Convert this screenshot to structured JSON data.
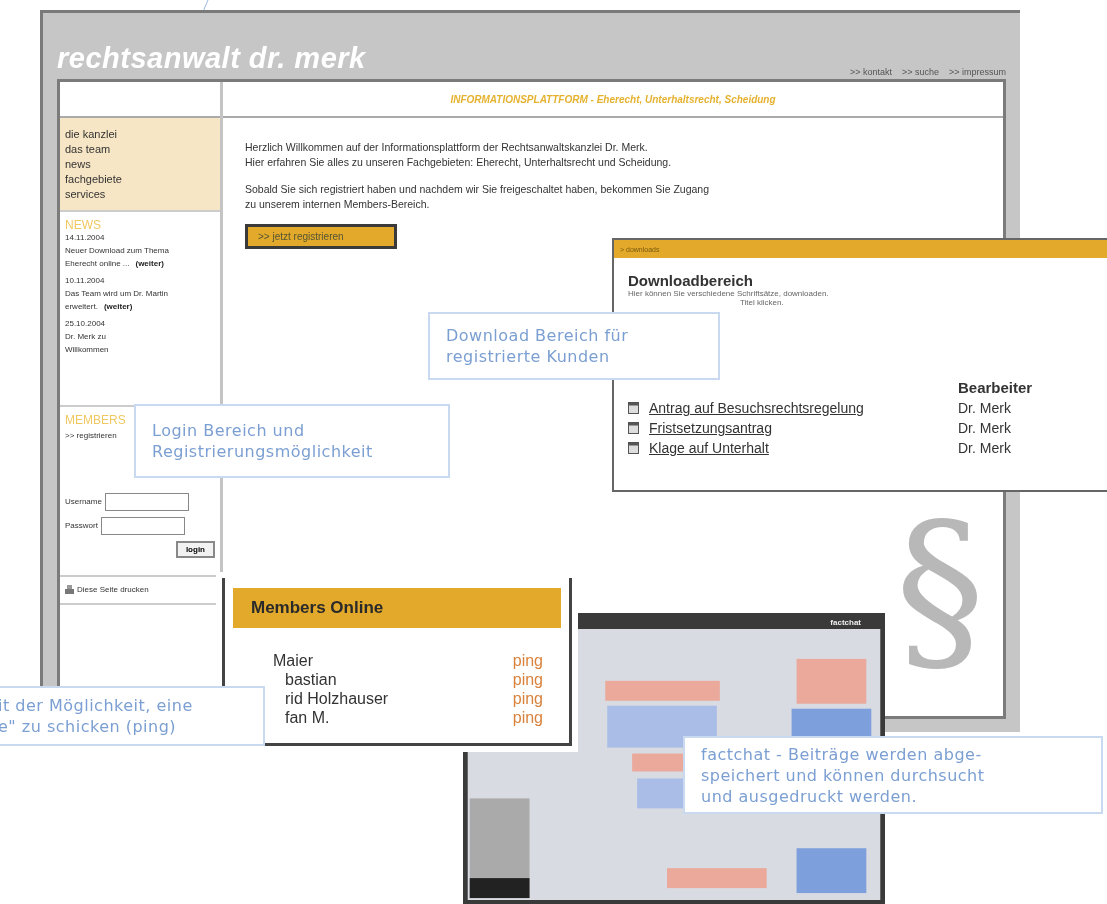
{
  "site": {
    "logo": "rechtsanwalt dr. merk",
    "top_links": [
      ">> kontakt",
      ">> suche",
      ">> impressum"
    ],
    "headline": "INFORMATIONSPLATTFORM - Eherecht, Unterhaltsrecht, Scheidung",
    "nav": [
      {
        "label": "die kanzlei"
      },
      {
        "label": "das team"
      },
      {
        "label": "news"
      },
      {
        "label": "fachgebiete"
      },
      {
        "label": "services"
      }
    ],
    "news_title": "NEWS",
    "news": [
      {
        "date": "14.11.2004",
        "lines": [
          "Neuer Download zum Thema",
          "Eherecht online ..."
        ],
        "more": "(weiter)"
      },
      {
        "date": "10.11.2004",
        "lines": [
          "Das Team wird um Dr. Martin",
          "erweitert."
        ],
        "more": "(weiter)"
      },
      {
        "date": "25.10.2004",
        "lines": [
          "Dr. Merk zu",
          "Willkommen"
        ]
      }
    ],
    "members_title": "MEMBERS",
    "register_link": ">> registrieren",
    "username_label": "Username",
    "password_label": "Passwort",
    "login_button": "login",
    "print_link": "Diese Seite drucken",
    "intro": [
      "Herzlich Willkommen auf der Informationsplattform der Rechtsanwaltskanzlei Dr. Merk.",
      "Hier erfahren Sie alles zu unseren Fachgebieten: Eherecht, Unterhaltsrecht und Scheidung."
    ],
    "intro2": [
      "Sobald Sie sich registriert haben und nachdem wir Sie freigeschaltet haben, bekommen Sie Zugang",
      "zu unserem internen Members-Bereich."
    ],
    "register_button": ">> jetzt registrieren"
  },
  "downloads": {
    "breadcrumb": "> downloads",
    "title": "Downloadbereich",
    "intro_lines": [
      "Hier können Sie verschiedene Schriftsätze, downloaden.",
      "Titel klicken."
    ],
    "author_header": "Bearbeiter",
    "rows": [
      {
        "title": "Antrag auf Besuchsrechtsregelung",
        "author": "Dr. Merk"
      },
      {
        "title": "Fristsetzungsantrag",
        "author": "Dr. Merk"
      },
      {
        "title": "Klage auf Unterhalt",
        "author": "Dr. Merk"
      }
    ]
  },
  "paragraph_sign": "§",
  "members_online": {
    "title": "Members Online",
    "members": [
      {
        "name": "Maier",
        "action": "ping"
      },
      {
        "name": "bastian",
        "action": "ping"
      },
      {
        "name": "rid Holzhauser",
        "action": "ping"
      },
      {
        "name": "fan M.",
        "action": "ping"
      }
    ]
  },
  "chat": {
    "title": "factchat"
  },
  "callouts": [
    {
      "lines": [
        "Download Bereich für",
        "registrierte Kunden"
      ]
    },
    {
      "lines": [
        "Login Bereich und",
        "Registrierungsmöglichkeit"
      ]
    },
    {
      "lines": [
        "it der Möglichkeit, eine",
        "e\" zu schicken (ping)"
      ]
    },
    {
      "lines": [
        "factchat - Beiträge werden abge-",
        "speichert und können durchsucht",
        "und ausgedruckt werden."
      ]
    }
  ]
}
